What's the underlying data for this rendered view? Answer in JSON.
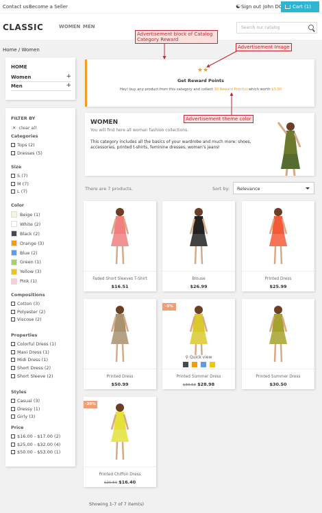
{
  "topbar": {
    "contact": "Contact us",
    "seller": "Become a Seller",
    "signout": "Sign out",
    "user": "John DOE",
    "cart": "Cart (1)"
  },
  "header": {
    "logo": "CLASSIC",
    "nav": [
      "WOMEN",
      "MEN"
    ],
    "search_placeholder": "Search our catalog"
  },
  "breadcrumb": [
    "Home",
    "Women"
  ],
  "category_panel": {
    "title": "HOME",
    "items": [
      "Women",
      "Men"
    ]
  },
  "filters": {
    "title": "FILTER BY",
    "clear": "clear all",
    "groups": [
      {
        "name": "Categories",
        "items": [
          "Tops (2)",
          "Dresses (5)"
        ]
      },
      {
        "name": "Size",
        "items": [
          "S (7)",
          "M (7)",
          "L (7)"
        ]
      },
      {
        "name": "Color",
        "items": [
          "Beige (1)",
          "White (2)",
          "Black (2)",
          "Orange (3)",
          "Blue (2)",
          "Green (1)",
          "Yellow (3)",
          "Pink (1)"
        ]
      },
      {
        "name": "Compositions",
        "items": [
          "Cotton (3)",
          "Polyester (2)",
          "Viscose (2)"
        ]
      },
      {
        "name": "Properties",
        "items": [
          "Colorful Dress (1)",
          "Maxi Dress (1)",
          "Midi Dress (1)",
          "Short Dress (2)",
          "Short Sleeve (2)"
        ]
      },
      {
        "name": "Styles",
        "items": [
          "Casual (3)",
          "Dressy (1)",
          "Girly (3)"
        ]
      },
      {
        "name": "Price",
        "items": [
          "$16.00 - $17.00 (2)",
          "$25.00 - $32.00 (4)",
          "$50.00 - $53.00 (1)"
        ]
      }
    ],
    "color_swatches": [
      "#f5f5dc",
      "#ffffff",
      "#434a54",
      "#f39c11",
      "#5d9cec",
      "#a0d468",
      "#f1c40f",
      "#fcccd7"
    ]
  },
  "reward": {
    "title": "Get Reward Points",
    "text_before": "Hey! buy any product from this category and collect",
    "points": "30 Reward Point(s)",
    "text_mid": "which worth",
    "worth": "$3.00",
    "accent": "#f39d19"
  },
  "category": {
    "title": "WOMEN",
    "subtitle": "You will find here all woman fashion collections.",
    "description": "This category includes all the basics of your wardrobe and much more: shoes, accessories, printed t-shirts, feminine dresses, women's jeans!"
  },
  "listing": {
    "count_text": "There are 7 products.",
    "sort_label": "Sort by:",
    "sort_value": "Relevance",
    "showing": "Showing 1-7 of 7 item(s)"
  },
  "products": [
    {
      "name": "Faded Short Sleeves T-Shirt",
      "price": "$16.51",
      "old_price": "",
      "badge": ""
    },
    {
      "name": "Blouse",
      "price": "$26.99",
      "old_price": "",
      "badge": ""
    },
    {
      "name": "Printed Dress",
      "price": "$25.99",
      "old_price": "",
      "badge": ""
    },
    {
      "name": "Printed Dress",
      "price": "$50.99",
      "old_price": "",
      "badge": ""
    },
    {
      "name": "Printed Summer Dress",
      "price": "$28.98",
      "old_price": "$30.50",
      "badge": "-5%"
    },
    {
      "name": "Printed Summer Dress",
      "price": "$30.50",
      "old_price": "",
      "badge": ""
    },
    {
      "name": "Printed Chiffon Dress",
      "price": "$16.40",
      "old_price": "$20.50",
      "badge": "-20%"
    }
  ],
  "quick_view": {
    "label": "Quick view",
    "colors": [
      "#434a54",
      "#f39c11",
      "#5d9cec",
      "#f1c40f"
    ]
  },
  "annotations": {
    "block": "Advertisement block of Catalog Category Reward",
    "image": "Advertisement Image",
    "theme": "Advertisement theme color"
  },
  "colors": {
    "accent": "#2fb5d2",
    "reward": "#f39d19",
    "annotation": "#c0262f"
  }
}
